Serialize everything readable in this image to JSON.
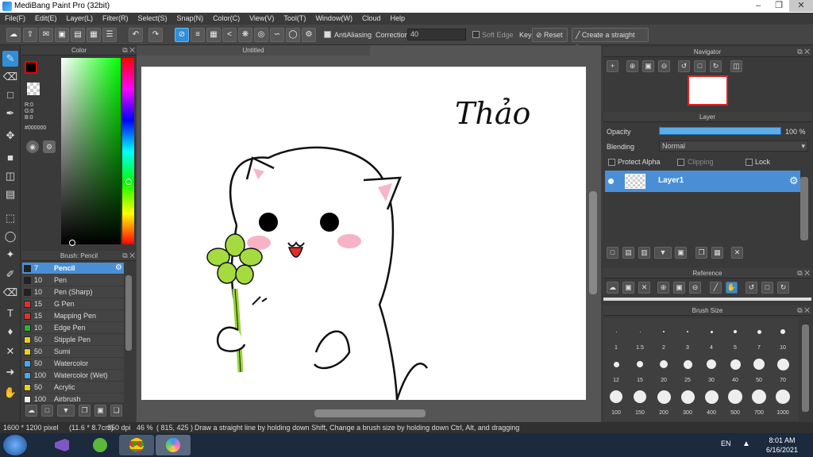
{
  "window": {
    "title": "MediBang Paint Pro (32bit)"
  },
  "menu": [
    "File(F)",
    "Edit(E)",
    "Layer(L)",
    "Filter(R)",
    "Select(S)",
    "Snap(N)",
    "Color(C)",
    "View(V)",
    "Tool(T)",
    "Window(W)",
    "Cloud",
    "Help"
  ],
  "toolbar": {
    "antialiasing_label": "AntiAliasing",
    "correction_label": "Correction",
    "correction_value": "40",
    "soft_edge_label": "Soft Edge",
    "key_label": "Key",
    "reset_label": "Reset",
    "straight_line_label": "Create a straight line"
  },
  "color_panel": {
    "title": "Color",
    "r": "R:0",
    "g": "G:0",
    "b": "B:0",
    "hex": "#000000",
    "current_color": "#000000"
  },
  "brush_panel": {
    "title": "Brush: Pencil",
    "items": [
      {
        "size": "7",
        "name": "Pencil",
        "color": "#222222"
      },
      {
        "size": "10",
        "name": "Pen",
        "color": "#222222"
      },
      {
        "size": "10",
        "name": "Pen (Sharp)",
        "color": "#222222"
      },
      {
        "size": "15",
        "name": "G Pen",
        "color": "#e03030"
      },
      {
        "size": "15",
        "name": "Mapping Pen",
        "color": "#e03030"
      },
      {
        "size": "10",
        "name": "Edge Pen",
        "color": "#30b030"
      },
      {
        "size": "50",
        "name": "Stipple Pen",
        "color": "#e8d020"
      },
      {
        "size": "50",
        "name": "Sumi",
        "color": "#e8d020"
      },
      {
        "size": "50",
        "name": "Watercolor",
        "color": "#4aa8e8"
      },
      {
        "size": "100",
        "name": "Watercolor (Wet)",
        "color": "#4aa8e8"
      },
      {
        "size": "50",
        "name": "Acrylic",
        "color": "#e8d020"
      },
      {
        "size": "100",
        "name": "Airbrush",
        "color": "#eeeeee"
      }
    ]
  },
  "canvas": {
    "tab_title": "Untitled",
    "signature": "Thảo"
  },
  "navigator": {
    "title": "Navigator"
  },
  "layer_panel": {
    "title": "Layer",
    "opacity_label": "Opacity",
    "opacity_value": "100 %",
    "opacity_fraction": 1.0,
    "blending_label": "Blending",
    "blending_value": "Normal",
    "protect_alpha": "Protect Alpha",
    "clipping": "Clipping",
    "lock": "Lock",
    "layer_name": "Layer1"
  },
  "reference": {
    "title": "Reference"
  },
  "brush_size": {
    "title": "Brush Size",
    "sizes": [
      "1",
      "1.5",
      "2",
      "3",
      "4",
      "5",
      "7",
      "10",
      "12",
      "15",
      "20",
      "25",
      "30",
      "40",
      "50",
      "70",
      "100",
      "150",
      "200",
      "300",
      "400",
      "500",
      "700",
      "1000"
    ]
  },
  "status": {
    "dimensions": "1600 * 1200 pixel",
    "physical": "(11.6 * 8.7cm)",
    "dpi": "350 dpi",
    "zoom": "46 %",
    "cursor": "( 815, 425 )",
    "hint": "Draw a straight line by holding down Shift, Change a brush size by holding down Ctrl, Alt, and dragging"
  },
  "taskbar": {
    "lang": "EN",
    "time": "8:01 AM",
    "date": "6/16/2021"
  }
}
